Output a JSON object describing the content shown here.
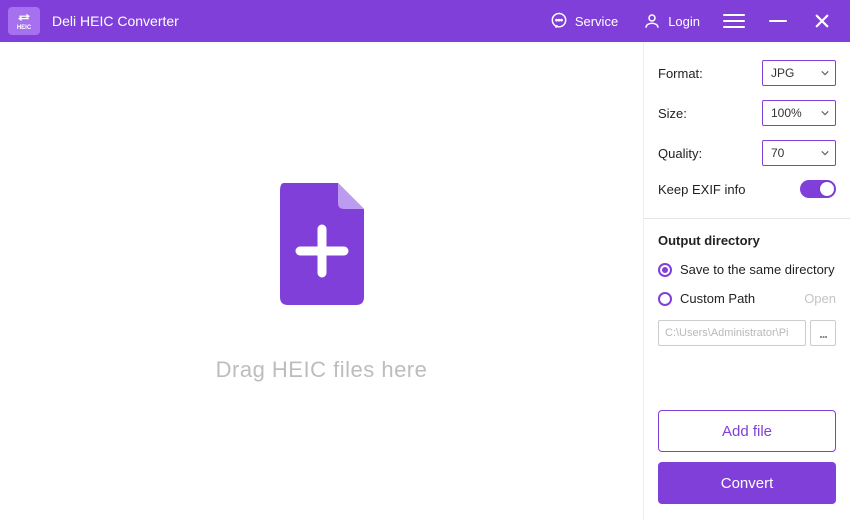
{
  "app": {
    "logo_text": "HEIC",
    "title": "Deli HEIC Converter"
  },
  "titlebar": {
    "service_label": "Service",
    "login_label": "Login"
  },
  "dropzone": {
    "hint": "Drag HEIC files here"
  },
  "settings": {
    "format": {
      "label": "Format:",
      "value": "JPG"
    },
    "size": {
      "label": "Size:",
      "value": "100%"
    },
    "quality": {
      "label": "Quality:",
      "value": "70"
    },
    "keep_exif": {
      "label": "Keep EXIF info",
      "enabled": true
    }
  },
  "output": {
    "section_title": "Output directory",
    "same_dir_label": "Save to the same directory",
    "custom_path_label": "Custom Path",
    "open_label": "Open",
    "path_value": "C:\\Users\\Administrator\\Pi",
    "browse_label": "..."
  },
  "actions": {
    "add_file": "Add file",
    "convert": "Convert"
  },
  "colors": {
    "accent": "#7f3fd8"
  }
}
